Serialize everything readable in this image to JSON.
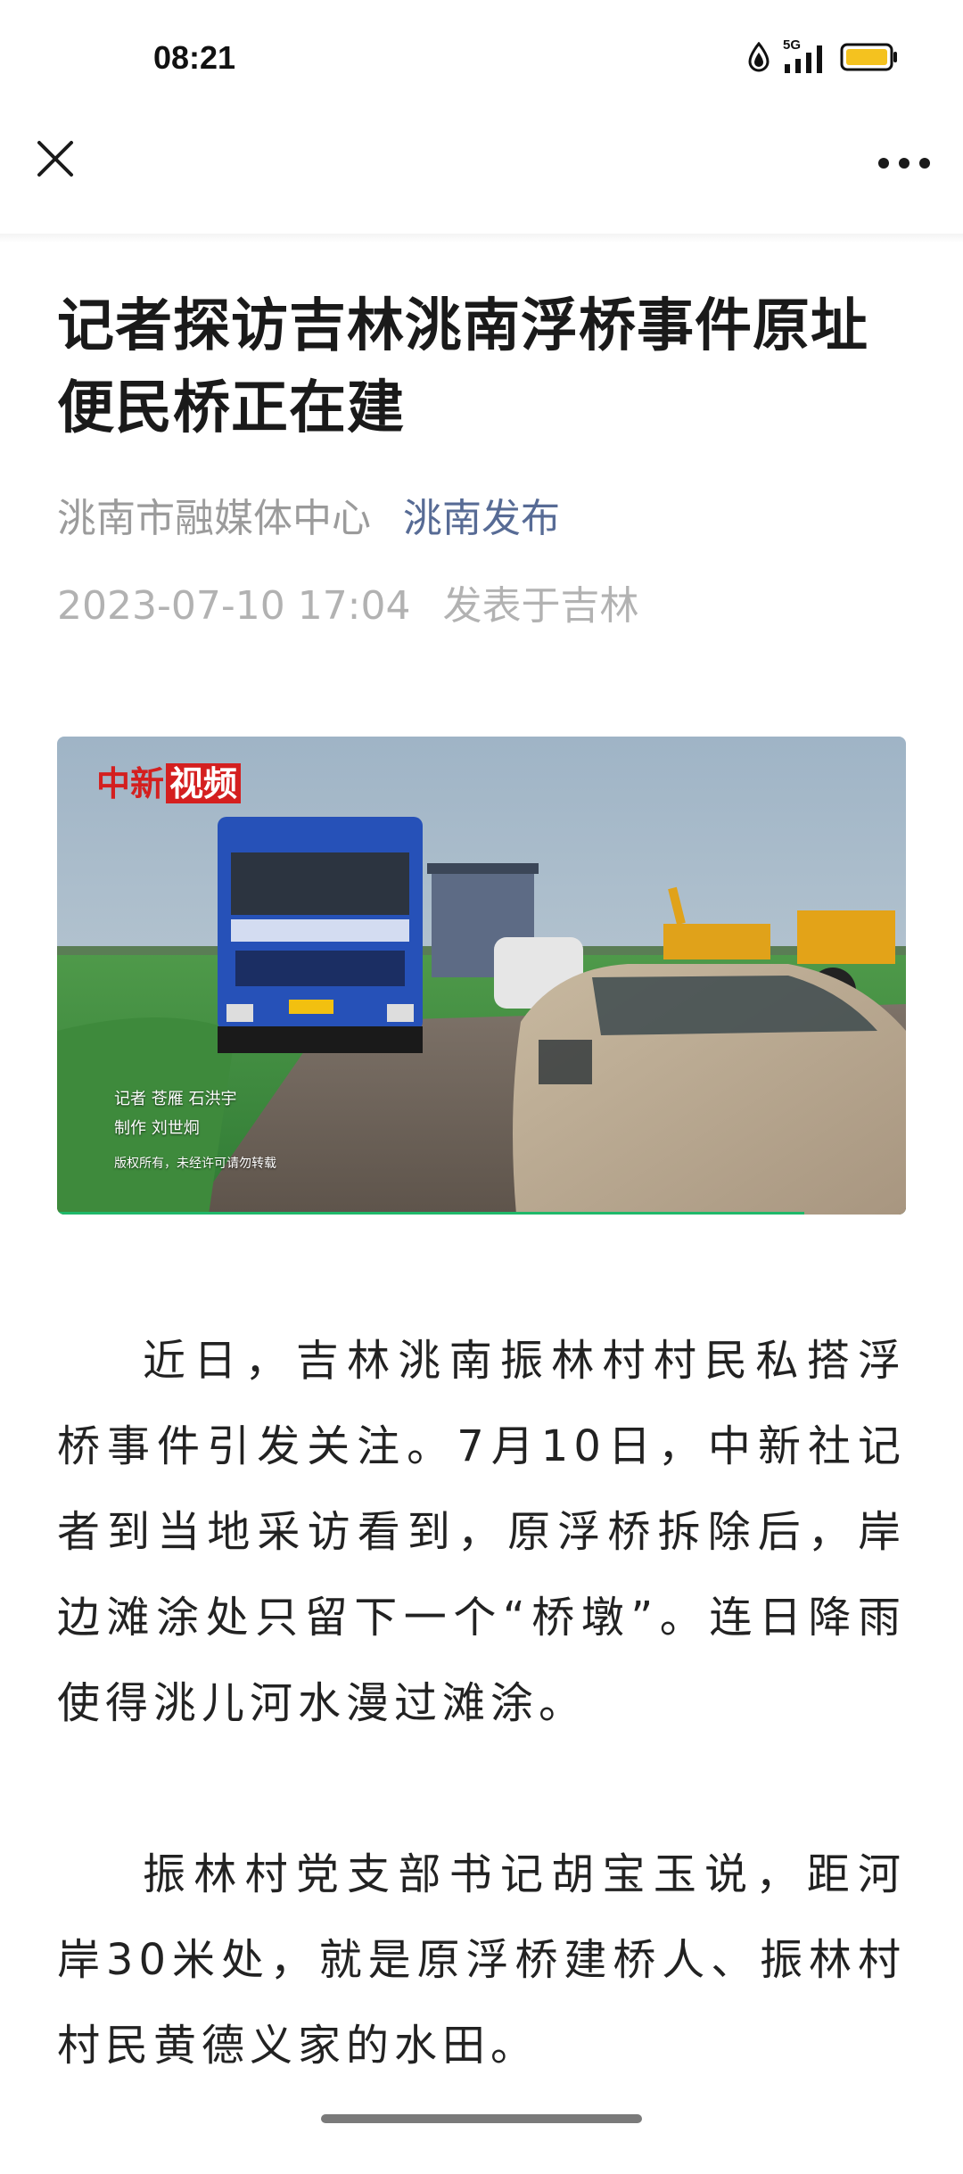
{
  "status_bar": {
    "time": "08:21",
    "network": "5G",
    "icons": [
      "data-saver-icon",
      "signal-icon",
      "battery-icon"
    ],
    "battery_color": "#f4c21f"
  },
  "nav": {
    "close_icon": "close-icon",
    "more_icon": "more-icon"
  },
  "article": {
    "title": "记者探访吉林洮南浮桥事件原址 便民桥正在建",
    "source": "洮南市融媒体中心",
    "account": "洮南发布",
    "datetime": "2023-07-10 17:04",
    "location": "发表于吉林",
    "account_color": "#576b95"
  },
  "video": {
    "logo_prefix": "中新",
    "logo_suffix": "视频",
    "credit_reporter": "记者 苍雁 石洪宇",
    "credit_producer": "制作 刘世炯",
    "copyright": "版权所有，未经许可请勿转载",
    "progress_percent": 88
  },
  "paragraphs": [
    "近日，吉林洮南振林村村民私搭浮桥事件引发关注。7月10日，中新社记者到当地采访看到，原浮桥拆除后，岸边滩涂处只留下一个“桥墩”。连日降雨使得洮儿河水漫过滩涂。",
    "振林村党支部书记胡宝玉说，距河岸30米处，就是原浮桥建桥人、振林村村民黄德义家的水田。"
  ]
}
